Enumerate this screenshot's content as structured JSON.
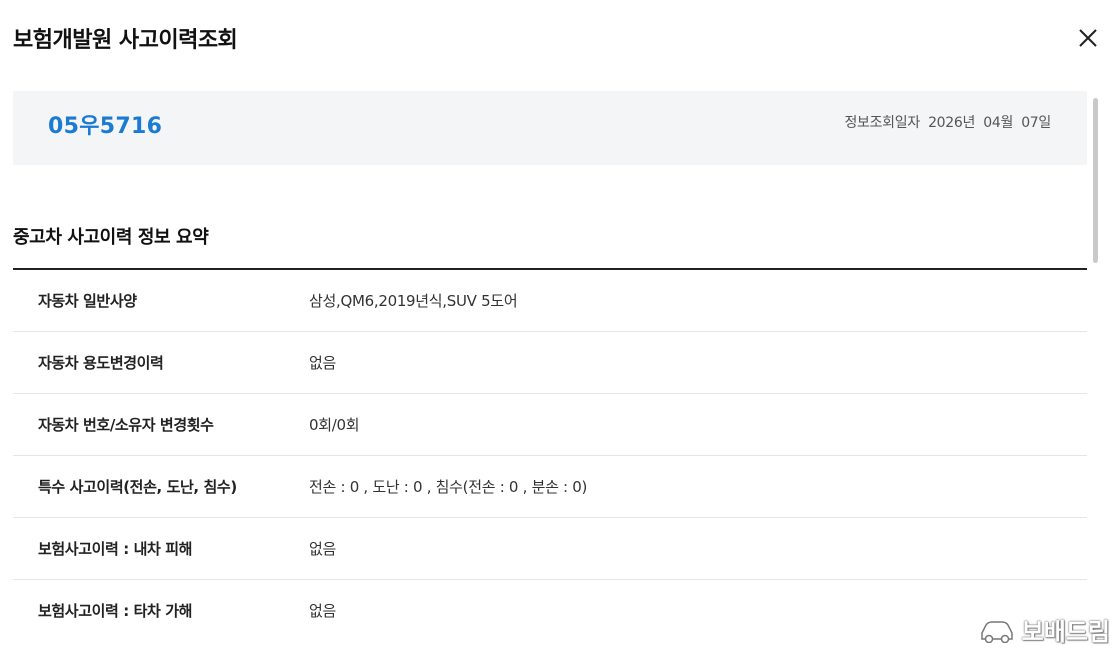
{
  "modal": {
    "title": "보험개발원 사고이력조회",
    "close_icon": "close-icon"
  },
  "vehicle": {
    "plate": "05우5716",
    "lookup_label": "정보조회일자",
    "lookup_year": "2026년",
    "lookup_month": "04월",
    "lookup_day": "07일"
  },
  "summary": {
    "title": "중고차 사고이력 정보 요약",
    "rows": [
      {
        "label": "자동차 일반사양",
        "value": "삼성,QM6,2019년식,SUV 5도어"
      },
      {
        "label": "자동차 용도변경이력",
        "value": "없음"
      },
      {
        "label": "자동차 번호/소유자 변경횟수",
        "value": "0회/0회"
      },
      {
        "label": "특수 사고이력(전손, 도난, 침수)",
        "value": "전손 : 0 , 도난 : 0 , 침수(전손 : 0 , 분손 : 0)"
      },
      {
        "label": "보험사고이력 : 내차 피해",
        "value": "없음"
      },
      {
        "label": "보험사고이력 : 타차 가해",
        "value": "없음"
      }
    ]
  },
  "watermark": {
    "text": "보배드림",
    "icon": "car-logo-icon"
  },
  "colors": {
    "accent": "#1b7ad3",
    "card_bg": "#f4f5f6",
    "rule": "#222222",
    "divider": "#e6e6e6"
  }
}
